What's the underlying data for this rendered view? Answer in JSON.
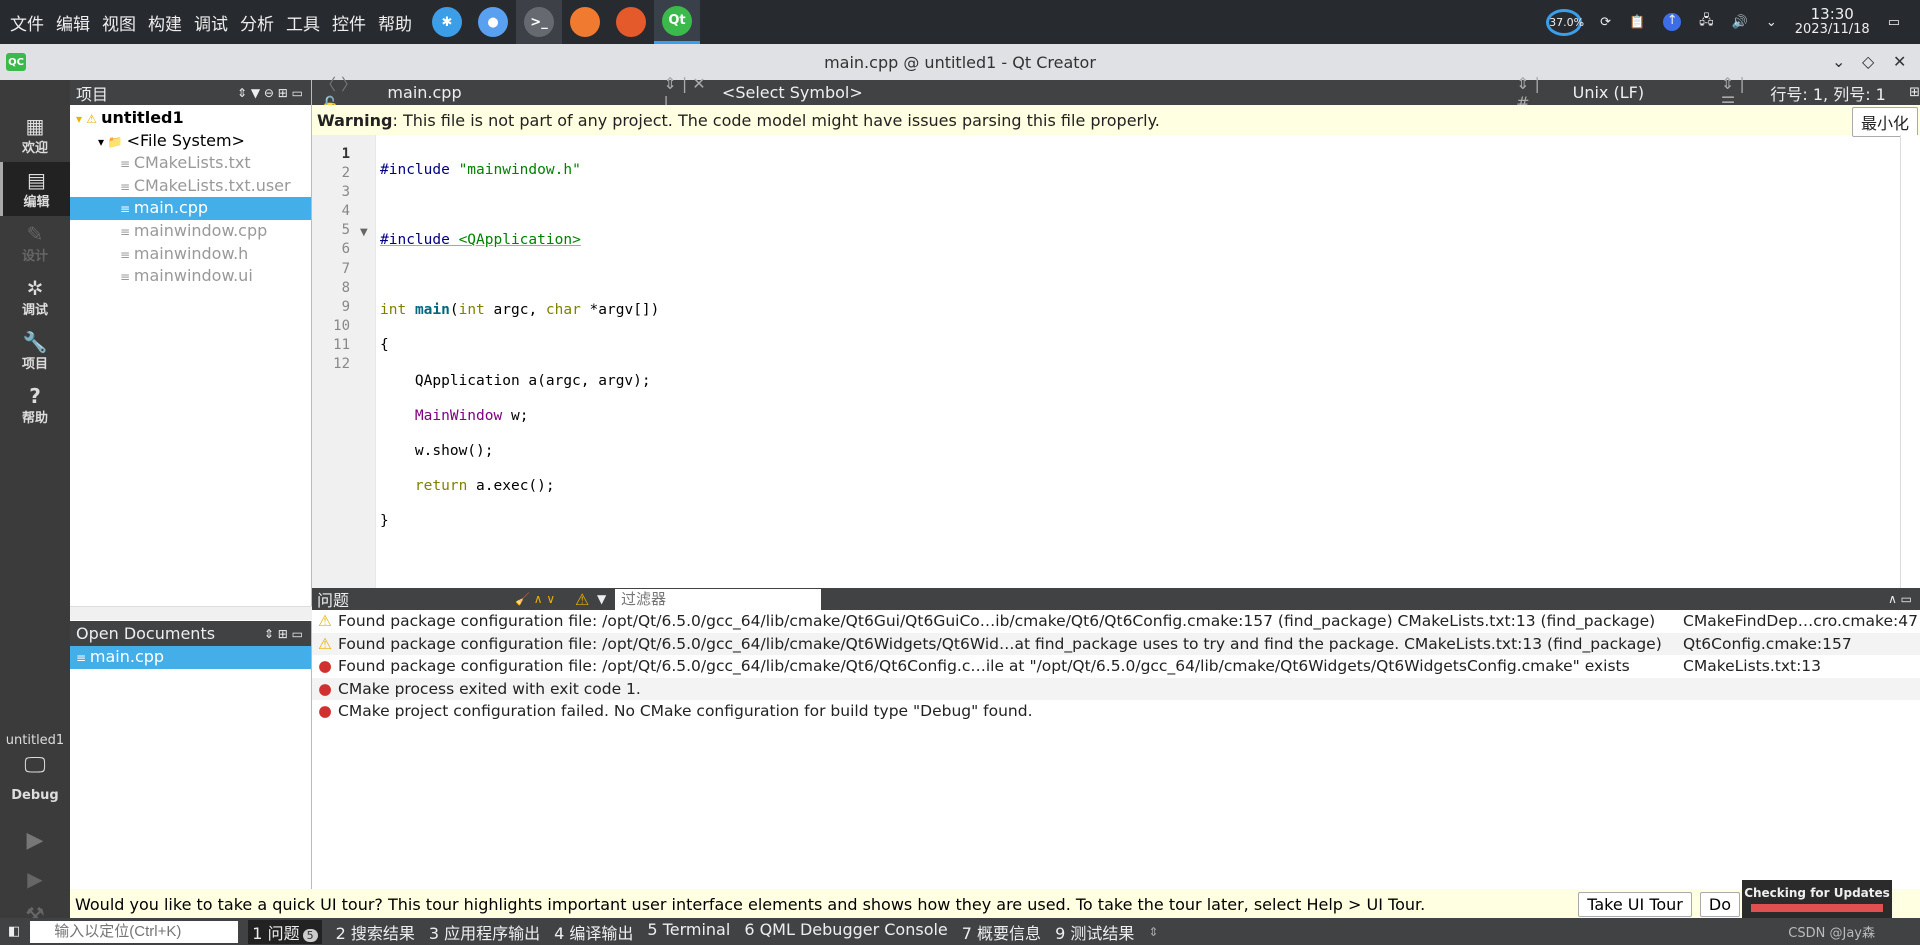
{
  "taskbar": {
    "menus": [
      "文件",
      "编辑",
      "视图",
      "构建",
      "调试",
      "分析",
      "工具",
      "控件",
      "帮助"
    ],
    "apps": [
      {
        "icon": "kde-icon",
        "label": "✱",
        "color": "#3d9ee8"
      },
      {
        "icon": "toggle-icon",
        "label": "●",
        "color": "#5aa0f0"
      },
      {
        "icon": "terminal-icon",
        "label": ">_",
        "color": "#666a70"
      },
      {
        "icon": "files-icon",
        "label": "",
        "color": "#f07a30"
      },
      {
        "icon": "firefox-icon",
        "label": "",
        "color": "#e45a2a"
      },
      {
        "icon": "qt-icon",
        "label": "Qt",
        "color": "#3bb94a"
      }
    ],
    "battery": "37.0%",
    "time": "13:30",
    "date": "2023/11/18"
  },
  "window": {
    "title": "main.cpp @ untitled1 - Qt Creator",
    "logo": "QC"
  },
  "modes": [
    {
      "label": "欢迎",
      "icon": "▦"
    },
    {
      "label": "编辑",
      "icon": "▤"
    },
    {
      "label": "设计",
      "icon": "✎"
    },
    {
      "label": "调试",
      "icon": "✲"
    },
    {
      "label": "项目",
      "icon": "🔧"
    },
    {
      "label": "帮助",
      "icon": "?"
    }
  ],
  "kit": {
    "project": "untitled1",
    "mode": "Debug"
  },
  "project_pane": {
    "title": "项目",
    "items": [
      {
        "label": "untitled1",
        "level": 0
      },
      {
        "label": "<File System>",
        "level": 1
      },
      {
        "label": "CMakeLists.txt",
        "level": 2
      },
      {
        "label": "CMakeLists.txt.user",
        "level": 2
      },
      {
        "label": "main.cpp",
        "level": 2,
        "selected": true
      },
      {
        "label": "mainwindow.cpp",
        "level": 2
      },
      {
        "label": "mainwindow.h",
        "level": 2
      },
      {
        "label": "mainwindow.ui",
        "level": 2
      }
    ]
  },
  "open_docs": {
    "title": "Open Documents",
    "items": [
      "main.cpp"
    ]
  },
  "editor": {
    "file": "main.cpp",
    "symbol": "<Select Symbol>",
    "line_ending": "Unix (LF)",
    "position": "行号: 1, 列号: 1",
    "warning_bold": "Warning",
    "warning_text": ": This file is not part of any project. The code model might have issues parsing this file properly.",
    "minimize": "最小化",
    "line_numbers": [
      "1",
      "2",
      "3",
      "4",
      "5",
      "6",
      "7",
      "8",
      "9",
      "10",
      "11",
      "12"
    ]
  },
  "issues": {
    "title": "问题",
    "filter_placeholder": "过滤器",
    "rows": [
      {
        "type": "warning",
        "text": "Found package configuration file: /opt/Qt/6.5.0/gcc_64/lib/cmake/Qt6Gui/Qt6GuiCo…ib/cmake/Qt6/Qt6Config.cmake:157 (find_package) CMakeLists.txt:13 (find_package)",
        "loc": "CMakeFindDep…cro.cmake:47"
      },
      {
        "type": "warning",
        "text": "Found package configuration file: /opt/Qt/6.5.0/gcc_64/lib/cmake/Qt6Widgets/Qt6Wid…at find_package uses to try and find the package. CMakeLists.txt:13 (find_package)",
        "loc": "Qt6Config.cmake:157"
      },
      {
        "type": "error",
        "text": "Found package configuration file: /opt/Qt/6.5.0/gcc_64/lib/cmake/Qt6/Qt6Config.c…ile at \"/opt/Qt/6.5.0/gcc_64/lib/cmake/Qt6Widgets/Qt6WidgetsConfig.cmake\" exists",
        "loc": "CMakeLists.txt:13"
      },
      {
        "type": "error",
        "text": "CMake process exited with exit code 1.",
        "loc": ""
      },
      {
        "type": "error",
        "text": "CMake project configuration failed. No CMake configuration for build type \"Debug\" found.",
        "loc": ""
      }
    ]
  },
  "tour": {
    "text": "Would you like to take a quick UI tour? This tour highlights important user interface elements and shows how they are used. To take the tour later, select Help > UI Tour.",
    "take": "Take UI Tour",
    "dont": "Do"
  },
  "updates": {
    "label": "Checking for Updates",
    "color": "#e05050"
  },
  "status": {
    "locator_placeholder": "输入以定位(Ctrl+K)",
    "tabs": [
      "1 问题",
      "2 搜索结果",
      "3 应用程序输出",
      "4 编译输出",
      "5 Terminal",
      "6 QML Debugger Console",
      "7 概要信息",
      "9 测试结果"
    ],
    "issues_count": "5",
    "watermark": "CSDN @Jay森"
  }
}
